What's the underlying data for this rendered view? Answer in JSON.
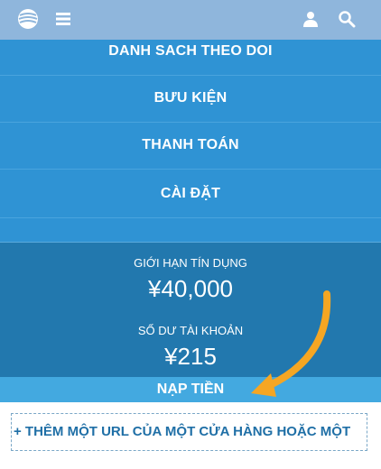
{
  "header": {
    "icons": [
      "logo-icon",
      "menu-icon",
      "user-icon",
      "search-icon"
    ]
  },
  "menu": {
    "items": [
      {
        "label": "DANH SACH THEO DOI"
      },
      {
        "label": "BƯU KIỆN"
      },
      {
        "label": "THANH TOÁN"
      },
      {
        "label": "CÀI ĐẶT"
      }
    ]
  },
  "credit": {
    "limit_label": "GIỚI HẠN TÍN DỤNG",
    "limit_value": "¥40,000",
    "balance_label": "SỐ DƯ TÀI KHOẢN",
    "balance_value": "¥215"
  },
  "actions": {
    "topup_label": "NẠP TIỀN",
    "add_url_label": "+ THÊM MỘT URL CỦA MỘT CỬA HÀNG HOẶC MỘT"
  },
  "colors": {
    "header_bg": "#8fb6dc",
    "menu_bg": "#2f93d4",
    "credit_bg": "#2278ae",
    "topup_bg": "#43a9e0",
    "arrow": "#f5a623"
  }
}
